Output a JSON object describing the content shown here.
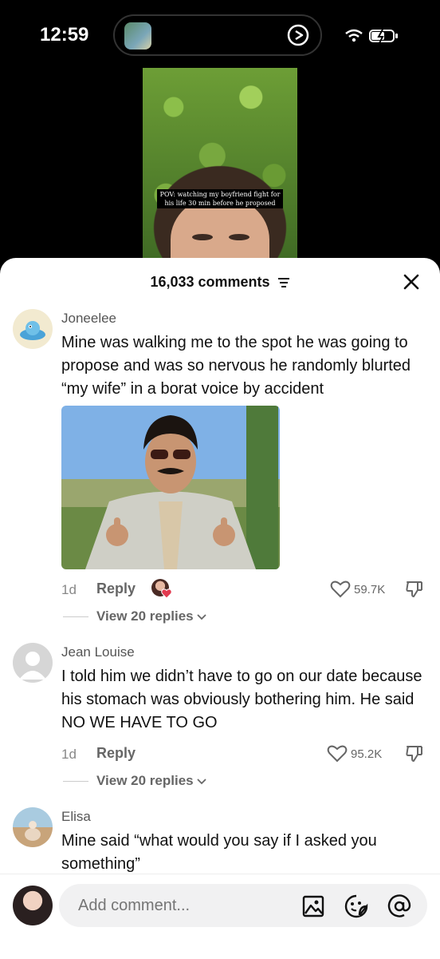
{
  "status": {
    "time": "12:59"
  },
  "video": {
    "caption": "POV: watching my boyfriend fight for his life 30 min before he proposed"
  },
  "comments_header": {
    "count_label": "16,033 comments"
  },
  "comments": [
    {
      "username": "Joneelee",
      "text": "Mine was walking me to the spot he was going to propose and was so nervous he randomly blurted “my wife” in a borat voice by accident",
      "age": "1d",
      "reply_label": "Reply",
      "likes": "59.7K",
      "view_replies": "View 20 replies"
    },
    {
      "username": "Jean Louise",
      "text": "I told him we didn’t have to go on our date because his stomach was obviously bothering him. He said NO WE HAVE TO GO",
      "age": "1d",
      "reply_label": "Reply",
      "likes": "95.2K",
      "view_replies": "View 20 replies"
    },
    {
      "username": "Elisa",
      "text": "Mine said “what would you say if I asked you something”"
    }
  ],
  "composer": {
    "placeholder": "Add comment..."
  },
  "colors": {
    "sheet_bg": "#ffffff",
    "text_primary": "#111111",
    "text_secondary": "#888888",
    "input_bg": "#f1f1f2",
    "like_heart": "#e23a4f"
  },
  "icons": [
    "filter-icon",
    "close-icon",
    "heart-icon",
    "dislike-icon",
    "chevron-down-icon",
    "image-icon",
    "emoji-icon",
    "mention-icon",
    "play-icon",
    "wifi-icon",
    "battery-icon"
  ]
}
